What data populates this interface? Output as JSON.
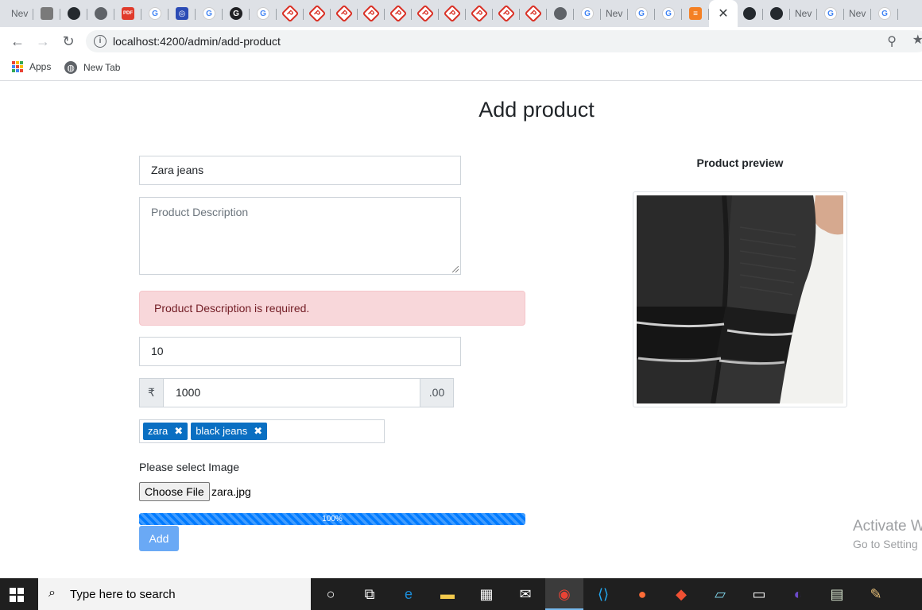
{
  "browser": {
    "tabs": [
      {
        "title": "Nev",
        "icon": "new-tab-icon",
        "color": "#5f6368"
      },
      {
        "title": "",
        "icon": "document-icon",
        "color": "#7a7a7a"
      },
      {
        "title": "",
        "icon": "github-icon",
        "color": "#24292e"
      },
      {
        "title": "",
        "icon": "globe-icon",
        "color": "#5f6368"
      },
      {
        "title": "",
        "icon": "pdf-icon",
        "color": "#e03b2c",
        "glyph": "PDF"
      },
      {
        "title": "",
        "icon": "google-icon",
        "color": "#4285f4",
        "glyph": "G"
      },
      {
        "title": "",
        "icon": "app-icon",
        "color": "#2b4bb5",
        "glyph": "◎"
      },
      {
        "title": "",
        "icon": "google-icon",
        "color": "#4285f4",
        "glyph": "G"
      },
      {
        "title": "",
        "icon": "g-dark-icon",
        "color": "#202124",
        "glyph": "G"
      },
      {
        "title": "",
        "icon": "google-icon",
        "color": "#4285f4",
        "glyph": "G"
      },
      {
        "title": "",
        "icon": "pp-icon",
        "color": "#d93025",
        "glyph": "P"
      },
      {
        "title": "",
        "icon": "pp-icon",
        "color": "#d93025",
        "glyph": "P"
      },
      {
        "title": "",
        "icon": "pp-icon",
        "color": "#d93025",
        "glyph": "P"
      },
      {
        "title": "",
        "icon": "pp-icon",
        "color": "#d93025",
        "glyph": "P"
      },
      {
        "title": "",
        "icon": "pp-icon",
        "color": "#d93025",
        "glyph": "P"
      },
      {
        "title": "",
        "icon": "pp-icon",
        "color": "#d93025",
        "glyph": "P"
      },
      {
        "title": "",
        "icon": "pp-icon",
        "color": "#d93025",
        "glyph": "P"
      },
      {
        "title": "",
        "icon": "pp-icon",
        "color": "#d93025",
        "glyph": "P"
      },
      {
        "title": "",
        "icon": "pp-icon",
        "color": "#d93025",
        "glyph": "P"
      },
      {
        "title": "",
        "icon": "pp-icon",
        "color": "#d93025",
        "glyph": "P"
      },
      {
        "title": "",
        "icon": "globe-icon",
        "color": "#5f6368"
      },
      {
        "title": "",
        "icon": "google-icon",
        "color": "#4285f4",
        "glyph": "G"
      },
      {
        "title": "Nev",
        "icon": "new-tab-icon",
        "color": "#5f6368"
      },
      {
        "title": "",
        "icon": "google-icon",
        "color": "#4285f4",
        "glyph": "G"
      },
      {
        "title": "",
        "icon": "google-icon",
        "color": "#4285f4",
        "glyph": "G"
      },
      {
        "title": "",
        "icon": "stackoverflow-icon",
        "color": "#f48024",
        "glyph": "≡"
      },
      {
        "title": "",
        "icon": "close-icon",
        "active": true
      },
      {
        "title": "",
        "icon": "github-icon",
        "color": "#24292e"
      },
      {
        "title": "",
        "icon": "github-icon",
        "color": "#24292e"
      },
      {
        "title": "Nev",
        "icon": "new-tab-icon",
        "color": "#5f6368"
      },
      {
        "title": "",
        "icon": "google-icon",
        "color": "#4285f4",
        "glyph": "G"
      },
      {
        "title": "Nev",
        "icon": "new-tab-icon",
        "color": "#5f6368"
      },
      {
        "title": "",
        "icon": "google-icon",
        "color": "#4285f4",
        "glyph": "G"
      }
    ],
    "url": "localhost:4200/admin/add-product",
    "bookmarks": [
      "Apps",
      "New Tab"
    ]
  },
  "page": {
    "title": "Add product",
    "name_value": "Zara jeans",
    "description_placeholder": "Product Description",
    "description_error": "Product Description is required.",
    "quantity_value": "10",
    "price_prefix": "₹",
    "price_value": "1000",
    "price_suffix": ".00",
    "tags": [
      "zara",
      "black jeans"
    ],
    "image_label": "Please select Image",
    "choose_file_label": "Choose File",
    "file_name": "zara.jpg",
    "upload_progress": 100,
    "upload_progress_label": "100%",
    "add_button_label": "Add",
    "preview_title": "Product preview"
  },
  "watermark": {
    "line1": "Activate W",
    "line2": "Go to Setting"
  },
  "taskbar": {
    "search_placeholder": "Type here to search",
    "apps": [
      "cortana-icon",
      "task-view-icon",
      "edge-icon",
      "file-explorer-icon",
      "store-icon",
      "mail-icon",
      "chrome-icon",
      "vscode-icon",
      "postman-icon",
      "git-icon",
      "notepad-icon",
      "terminal-icon",
      "eclipse-icon",
      "app-window-icon",
      "paint-icon"
    ]
  },
  "colors": {
    "primary": "#007bff",
    "alert_bg": "#f8d7da",
    "alert_text": "#721c24",
    "chip": "#0a6fc2"
  }
}
